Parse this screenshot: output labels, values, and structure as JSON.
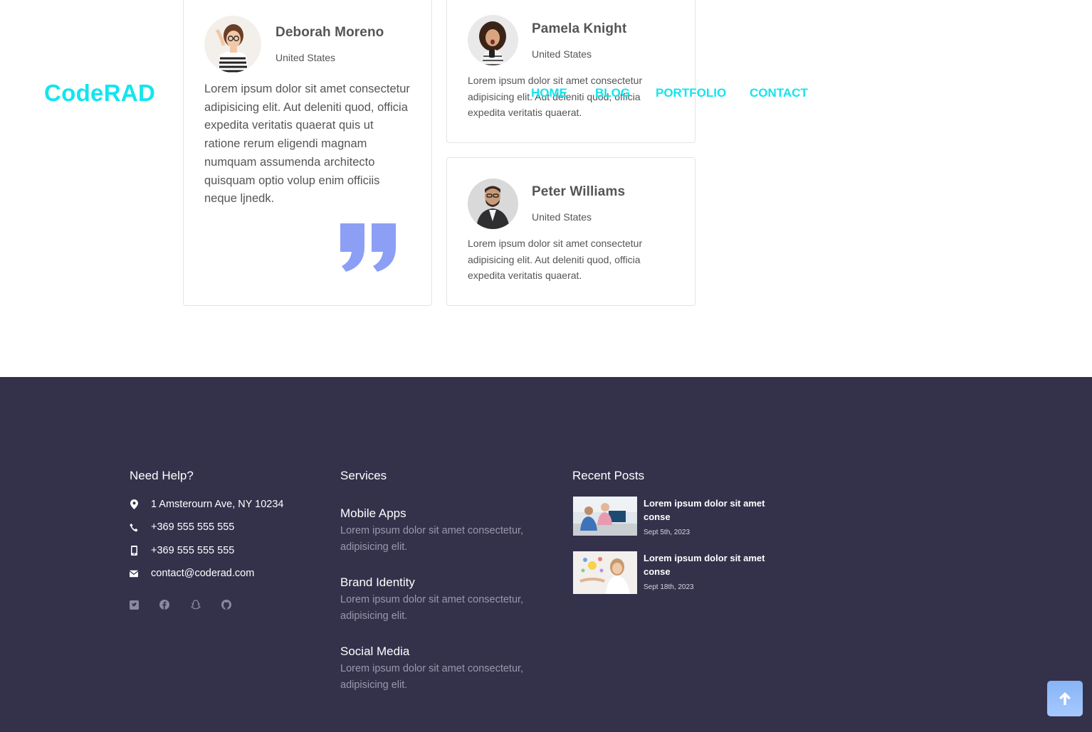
{
  "header": {
    "logo": "CodeRAD",
    "nav": [
      "HOME",
      "BLOG",
      "PORTFOLIO",
      "CONTACT"
    ]
  },
  "testimonials": [
    {
      "name": "Deborah Moreno",
      "location": "United States",
      "text": "Lorem ipsum dolor sit amet consectetur adipisicing elit. Aut deleniti quod, officia expedita veritatis quaerat quis ut ratione rerum eligendi magnam numquam assumenda architecto quisquam optio volup enim officiis neque ljnedk."
    },
    {
      "name": "Pamela Knight",
      "location": "United States",
      "text": "Lorem ipsum dolor sit amet consectetur adipisicing elit. Aut deleniti quod, officia expedita veritatis quaerat."
    },
    {
      "name": "Peter Williams",
      "location": "United States",
      "text": "Lorem ipsum dolor sit amet consectetur adipisicing elit. Aut deleniti quod, officia expedita veritatis quaerat."
    }
  ],
  "footer": {
    "help": {
      "title": "Need Help?",
      "address": "1 Amsterourn Ave, NY 10234",
      "phone": "+369 555 555 555",
      "mobile": "+369 555 555 555",
      "email": "contact@coderad.com",
      "social_icons": [
        "twitter-icon",
        "facebook-icon",
        "snapchat-icon",
        "github-icon"
      ]
    },
    "services": {
      "title": "Services",
      "items": [
        {
          "title": "Mobile Apps",
          "desc": "Lorem ipsum dolor sit amet consectetur, adipisicing elit."
        },
        {
          "title": "Brand Identity",
          "desc": "Lorem ipsum dolor sit amet consectetur, adipisicing elit."
        },
        {
          "title": "Social Media",
          "desc": "Lorem ipsum dolor sit amet consectetur, adipisicing elit."
        }
      ]
    },
    "recent_posts": {
      "title": "Recent Posts",
      "items": [
        {
          "title": "Lorem ipsum dolor sit amet conse",
          "date": "Sept 5th, 2023"
        },
        {
          "title": "Lorem ipsum dolor sit amet conse",
          "date": "Sept 18th, 2023"
        }
      ]
    }
  },
  "colors": {
    "accent": "#12e5ee",
    "footer_bg": "#34314b",
    "quote_mark": "#8c9ff5",
    "back_to_top": "#9ebff8"
  }
}
